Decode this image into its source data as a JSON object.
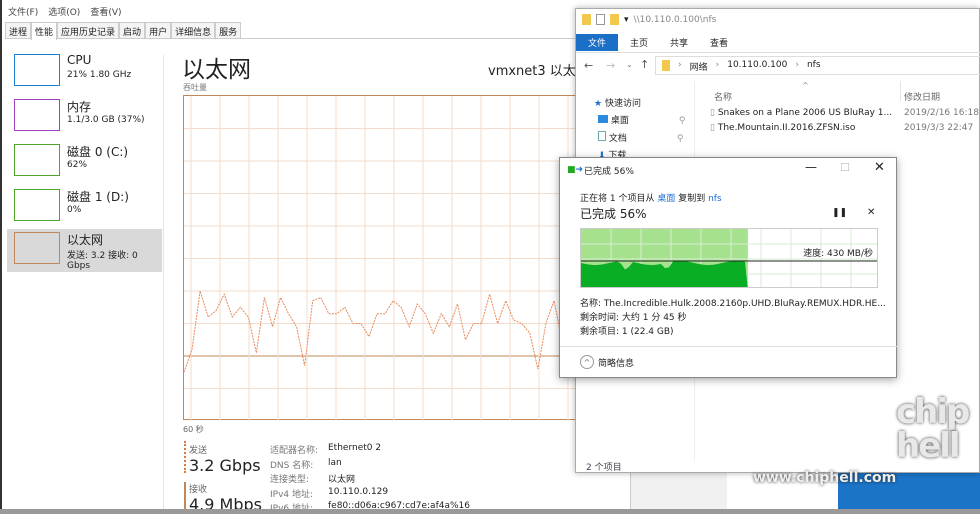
{
  "taskmgr": {
    "menu": [
      "文件(F)",
      "选项(O)",
      "查看(V)"
    ],
    "tabs": [
      "进程",
      "性能",
      "应用历史记录",
      "启动",
      "用户",
      "详细信息",
      "服务"
    ],
    "active_tab": "性能",
    "sidebar": [
      {
        "name": "CPU",
        "value": "21% 1.80 GHz",
        "color": "#1a7fd0"
      },
      {
        "name": "内存",
        "value": "1.1/3.0 GB (37%)",
        "color": "#a040c0"
      },
      {
        "name": "磁盘 0 (C:)",
        "value": "62%",
        "color": "#4da82a"
      },
      {
        "name": "磁盘 1 (D:)",
        "value": "0%",
        "color": "#4da82a"
      },
      {
        "name": "以太网",
        "value": "发送: 3.2 接收: 0 Gbps",
        "color": "#c0885a",
        "selected": true
      }
    ],
    "title": "以太网",
    "adapter": "vmxnet3 以太网",
    "graph_label": "吞吐量",
    "time_label": "60 秒",
    "throughput_percent": [
      15,
      22,
      40,
      32,
      34,
      39,
      32,
      35,
      32,
      21,
      38,
      29,
      38,
      33,
      29,
      17,
      37,
      38,
      33,
      33,
      35,
      30,
      30,
      26,
      33,
      33,
      37,
      35,
      29,
      36,
      33,
      27,
      33,
      29,
      36,
      25,
      30,
      30,
      39,
      30,
      37,
      31,
      30,
      27,
      16,
      30,
      37,
      25
    ],
    "send_label": "发送",
    "send_value": "3.2 Gbps",
    "recv_label": "接收",
    "recv_value": "4.9 Mbps",
    "props": [
      {
        "label": "适配器名称:",
        "value": "Ethernet0 2"
      },
      {
        "label": "DNS 名称:",
        "value": "lan"
      },
      {
        "label": "连接类型:",
        "value": "以太网"
      },
      {
        "label": "IPv4 地址:",
        "value": "10.110.0.129"
      },
      {
        "label": "IPv6 地址:",
        "value": "fe80::d06a:c967:cd7e:af4a%16"
      }
    ]
  },
  "explorer": {
    "path": "\\\\10.110.0.100\\nfs",
    "ribbon": [
      "文件",
      "主页",
      "共享",
      "查看"
    ],
    "breadcrumb": [
      "网络",
      "10.110.0.100",
      "nfs"
    ],
    "nav": [
      "快速访问",
      "桌面",
      "文档",
      "下载"
    ],
    "columns": [
      "名称",
      "修改日期"
    ],
    "files": [
      {
        "name": "Snakes on a Plane 2006 US BluRay 1...",
        "date": "2019/2/16 16:18"
      },
      {
        "name": "The.Mountain.II.2016.ZFSN.iso",
        "date": "2019/3/3 22:47"
      }
    ],
    "status": "2 个项目"
  },
  "copy": {
    "title": "已完成 56%",
    "desc_pre": "正在将 1 个项目从 ",
    "src": "桌面",
    "desc_mid": " 复制到 ",
    "dst": "nfs",
    "progress_label": "已完成 56%",
    "progress": 56,
    "speed": "速度: 430 MB/秒",
    "name": "名称: The.Incredible.Hulk.2008.2160p.UHD.BluRay.REMUX.HDR.HE...",
    "remaining_time": "剩余时间: 大约 1 分 45 秒",
    "remaining_items": "剩余项目: 1 (22.4 GB)",
    "less_details": "简略信息"
  },
  "watermark": {
    "logo": "chip hell",
    "url": "www.chiphell.com"
  }
}
